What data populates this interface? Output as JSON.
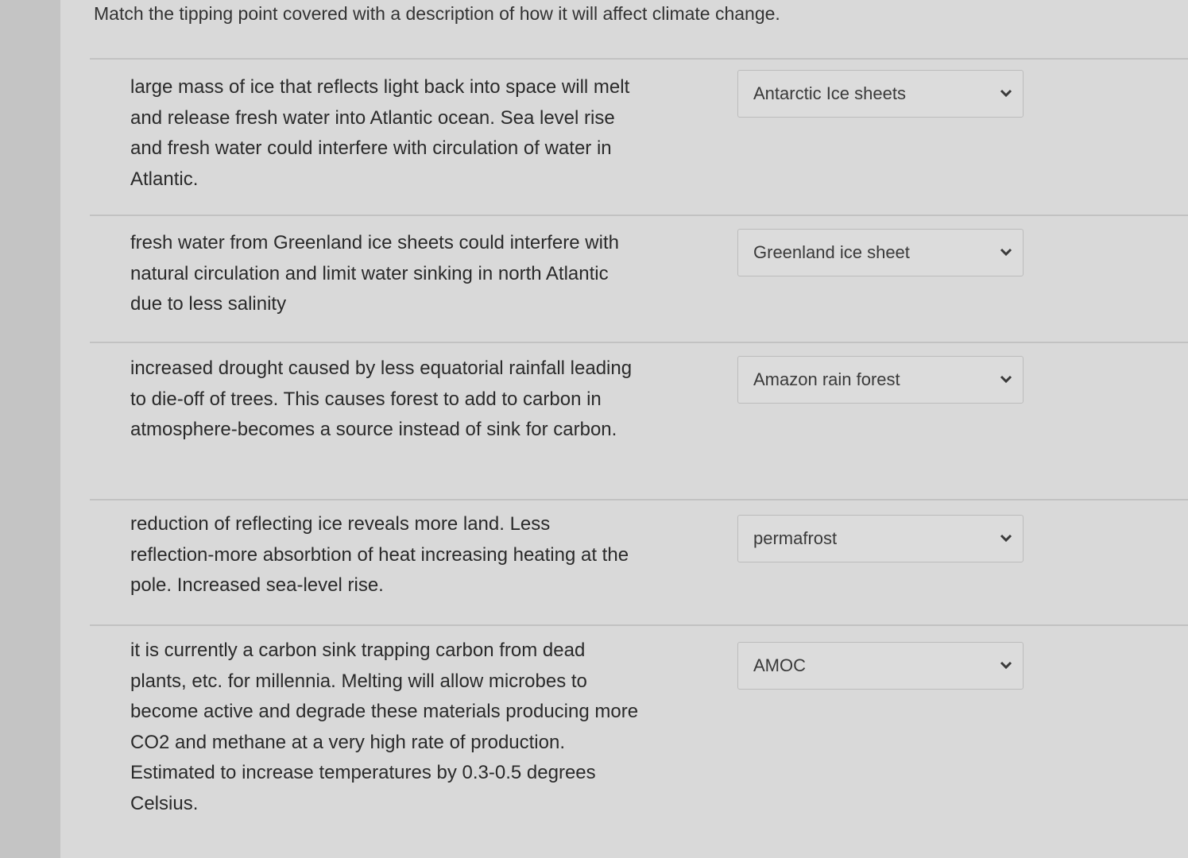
{
  "prompt": "Match the tipping point covered with a description of how it will affect climate change.",
  "items": [
    {
      "description": "large mass of ice that reflects light back into space will melt and release fresh water into Atlantic ocean. Sea level rise and fresh water could interfere with circulation of water in Atlantic.",
      "selected": "Antarctic Ice sheets"
    },
    {
      "description": "fresh water from Greenland ice sheets could interfere with natural circulation and limit water sinking in north Atlantic due to less salinity",
      "selected": "Greenland ice sheet"
    },
    {
      "description": "increased drought caused by less equatorial rainfall leading to die-off of trees. This causes forest to add to carbon in atmosphere-becomes a source instead of sink for carbon.",
      "selected": "Amazon rain forest"
    },
    {
      "description": "reduction of reflecting ice reveals more land. Less reflection-more absorbtion of heat increasing heating at the pole. Increased sea-level rise.",
      "selected": "permafrost"
    },
    {
      "description": "it is currently a carbon sink trapping carbon from dead plants, etc. for millennia. Melting will allow microbes to become active and degrade these materials producing more CO2 and methane at a very high rate of production. Estimated to increase temperatures by 0.3-0.5 degrees Celsius.",
      "selected": "AMOC"
    }
  ],
  "dropdown_icon": "chevron-down-icon"
}
